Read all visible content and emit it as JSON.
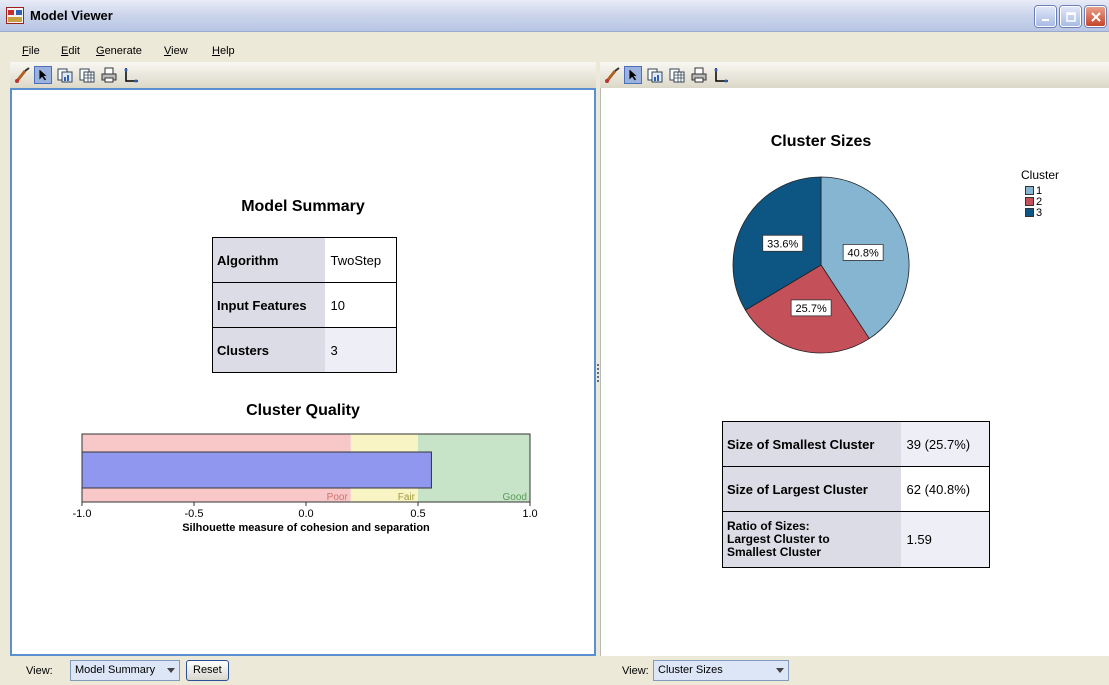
{
  "window": {
    "title": "Model Viewer"
  },
  "menu": [
    {
      "label": "File",
      "underline": "F",
      "rest": "ile"
    },
    {
      "label": "Edit",
      "underline": "E",
      "rest": "dit"
    },
    {
      "label": "Generate",
      "underline": "G",
      "rest": "enerate"
    },
    {
      "label": "View",
      "underline": "V",
      "rest": "iew"
    },
    {
      "label": "Help",
      "underline": "H",
      "rest": "elp"
    }
  ],
  "toolbar_icons": [
    "paint-brush-icon",
    "pointer-icon",
    "copy-chart-icon",
    "copy-data-icon",
    "print-icon",
    "axis-icon"
  ],
  "left": {
    "model_summary": {
      "title": "Model Summary",
      "rows": [
        {
          "label": "Algorithm",
          "value": "TwoStep"
        },
        {
          "label": "Input Features",
          "value": "10"
        },
        {
          "label": "Clusters",
          "value": "3"
        }
      ]
    },
    "cluster_quality": {
      "title": "Cluster Quality",
      "xlabel": "Silhouette measure of cohesion and separation",
      "ticks": [
        "-1.0",
        "-0.5",
        "0.0",
        "0.5",
        "1.0"
      ],
      "zones": [
        {
          "label": "Poor",
          "from": -1.0,
          "to": 0.2,
          "color": "#f8c8c8",
          "label_color": "#d07070"
        },
        {
          "label": "Fair",
          "from": 0.2,
          "to": 0.5,
          "color": "#f8f4c4",
          "label_color": "#a09a40"
        },
        {
          "label": "Good",
          "from": 0.5,
          "to": 1.0,
          "color": "#c8e4c8",
          "label_color": "#5a9a5a"
        }
      ],
      "value": 0.56,
      "bar_color": "#9097ee"
    },
    "footer": {
      "view_label": "View:",
      "view_value": "Model Summary",
      "reset_label": "Reset"
    }
  },
  "right": {
    "cluster_sizes": {
      "title": "Cluster Sizes",
      "legend_title": "Cluster",
      "slices": [
        {
          "name": "1",
          "label": "40.8%",
          "value": 40.8,
          "color": "#86b5d2"
        },
        {
          "name": "2",
          "label": "25.7%",
          "value": 25.7,
          "color": "#c4505a"
        },
        {
          "name": "3",
          "label": "33.6%",
          "value": 33.6,
          "color": "#0d5583"
        }
      ]
    },
    "stats": [
      {
        "label": "Size of Smallest Cluster",
        "value": "39 (25.7%)"
      },
      {
        "label": "Size of Largest Cluster",
        "value": "62 (40.8%)"
      },
      {
        "label": "Ratio of Sizes: Largest Cluster to Smallest Cluster",
        "label_lines": [
          "Ratio of Sizes:",
          "Largest Cluster to",
          "Smallest Cluster"
        ],
        "value": "1.59"
      }
    ],
    "footer": {
      "view_label": "View:",
      "view_value": "Cluster Sizes"
    }
  }
}
